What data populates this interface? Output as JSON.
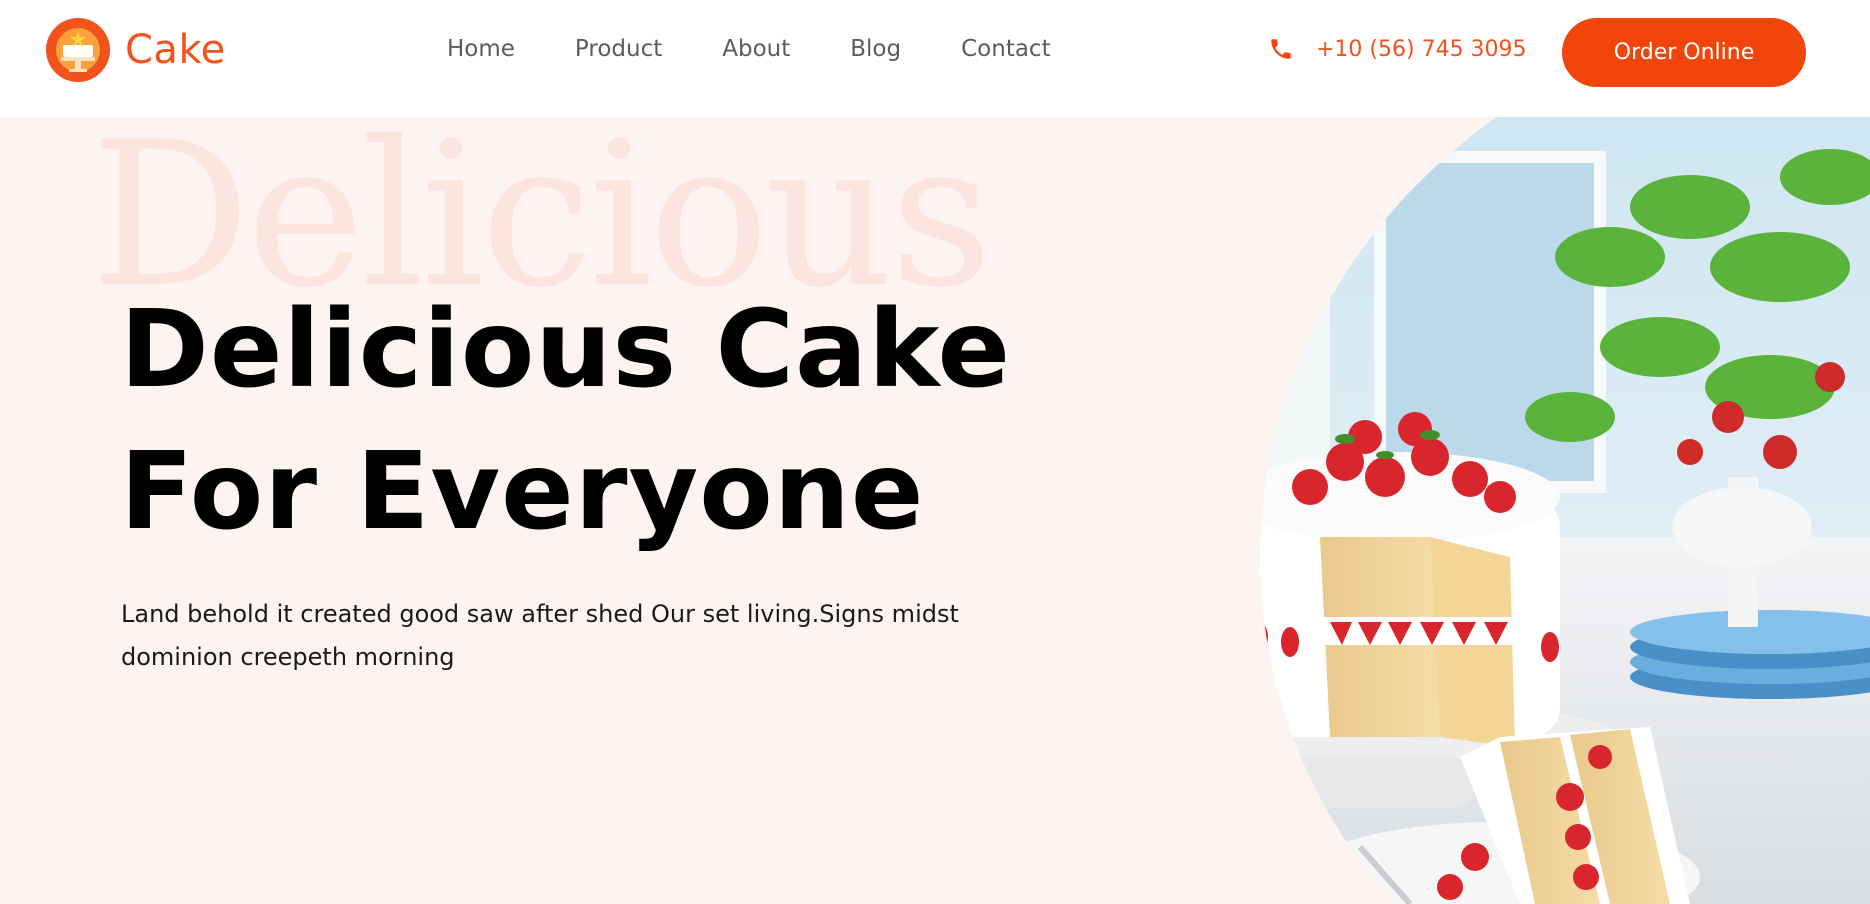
{
  "brand": {
    "name": "Cake",
    "logo_icon": "cake-logo-icon"
  },
  "nav": {
    "items": [
      {
        "label": "Home"
      },
      {
        "label": "Product"
      },
      {
        "label": "About"
      },
      {
        "label": "Blog"
      },
      {
        "label": "Contact"
      }
    ]
  },
  "contact": {
    "phone": "+10 (56) 745 3095",
    "icon": "phone-icon"
  },
  "cta": {
    "label": "Order Online"
  },
  "hero": {
    "watermark": "Delicious",
    "title_line1": "Delicious Cake",
    "title_line2": "For Everyone",
    "description": "Land behold it created good saw after shed Our set living.Signs midst dominion creepeth morning",
    "image": "strawberry-layer-cake-photo"
  },
  "colors": {
    "accent": "#f2450c",
    "hero_background": "#fdf3f1",
    "watermark": "#fbe5de",
    "nav_text": "#5c5c5c"
  }
}
